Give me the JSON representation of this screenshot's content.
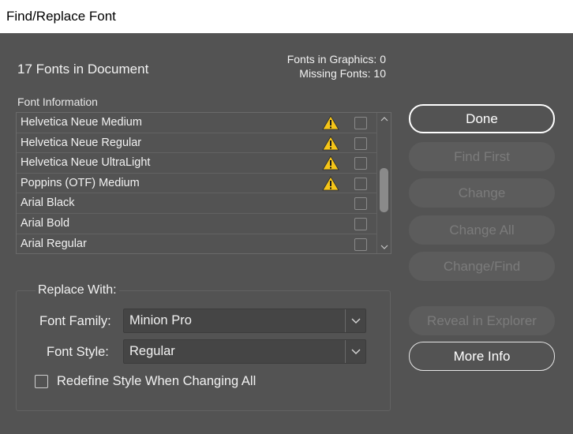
{
  "window": {
    "title": "Find/Replace Font"
  },
  "summary": {
    "title": "17 Fonts in Document",
    "fonts_in_graphics": "Fonts in Graphics: 0",
    "missing_fonts": "Missing Fonts: 10"
  },
  "font_list": {
    "label": "Font Information",
    "rows": [
      {
        "name": "Helvetica Neue Medium",
        "warning": true
      },
      {
        "name": "Helvetica Neue Regular",
        "warning": true
      },
      {
        "name": "Helvetica Neue UltraLight",
        "warning": true
      },
      {
        "name": "Poppins (OTF) Medium",
        "warning": true
      },
      {
        "name": "Arial Black",
        "warning": false
      },
      {
        "name": "Arial Bold",
        "warning": false
      },
      {
        "name": "Arial Regular",
        "warning": false
      }
    ]
  },
  "buttons": {
    "done": "Done",
    "find_first": "Find First",
    "change": "Change",
    "change_all": "Change All",
    "change_find": "Change/Find",
    "reveal": "Reveal in Explorer",
    "more_info": "More Info"
  },
  "replace": {
    "label": "Replace With:",
    "family_label": "Font Family:",
    "family_value": "Minion Pro",
    "style_label": "Font Style:",
    "style_value": "Regular",
    "redefine_label": "Redefine Style When Changing All",
    "redefine_checked": false
  },
  "colors": {
    "background": "#535353",
    "warning": "#f5c518"
  },
  "icons": {
    "warning": "warning-triangle-icon",
    "dropdown": "chevron-down-icon"
  }
}
